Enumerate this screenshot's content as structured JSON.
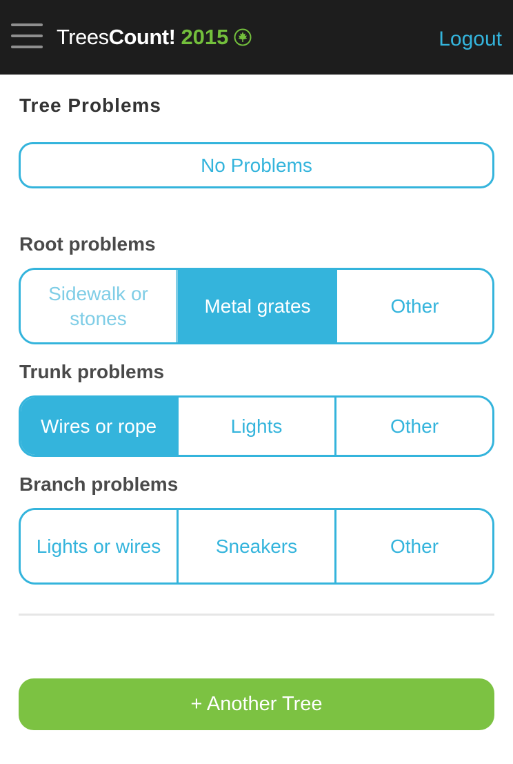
{
  "header": {
    "brand_trees": "Trees",
    "brand_count": "Count!",
    "brand_year": "2015",
    "logout_label": "Logout",
    "menu_icon": "hamburger-menu-icon",
    "leaf_icon": "maple-leaf-icon"
  },
  "title": "Tree Problems",
  "no_problems_label": "No Problems",
  "root": {
    "label": "Root problems",
    "options": [
      "Sidewalk or stones",
      "Metal grates",
      "Other"
    ],
    "selected": "Metal grates"
  },
  "trunk": {
    "label": "Trunk problems",
    "options": [
      "Wires or rope",
      "Lights",
      "Other"
    ],
    "selected": "Wires or rope"
  },
  "branch": {
    "label": "Branch problems",
    "options": [
      "Lights or wires",
      "Sneakers",
      "Other"
    ],
    "selected": ""
  },
  "another_tree_label": "+ Another Tree",
  "colors": {
    "accent": "#34b4dc",
    "green": "#7cc242",
    "header_bg": "#1d1d1d"
  }
}
